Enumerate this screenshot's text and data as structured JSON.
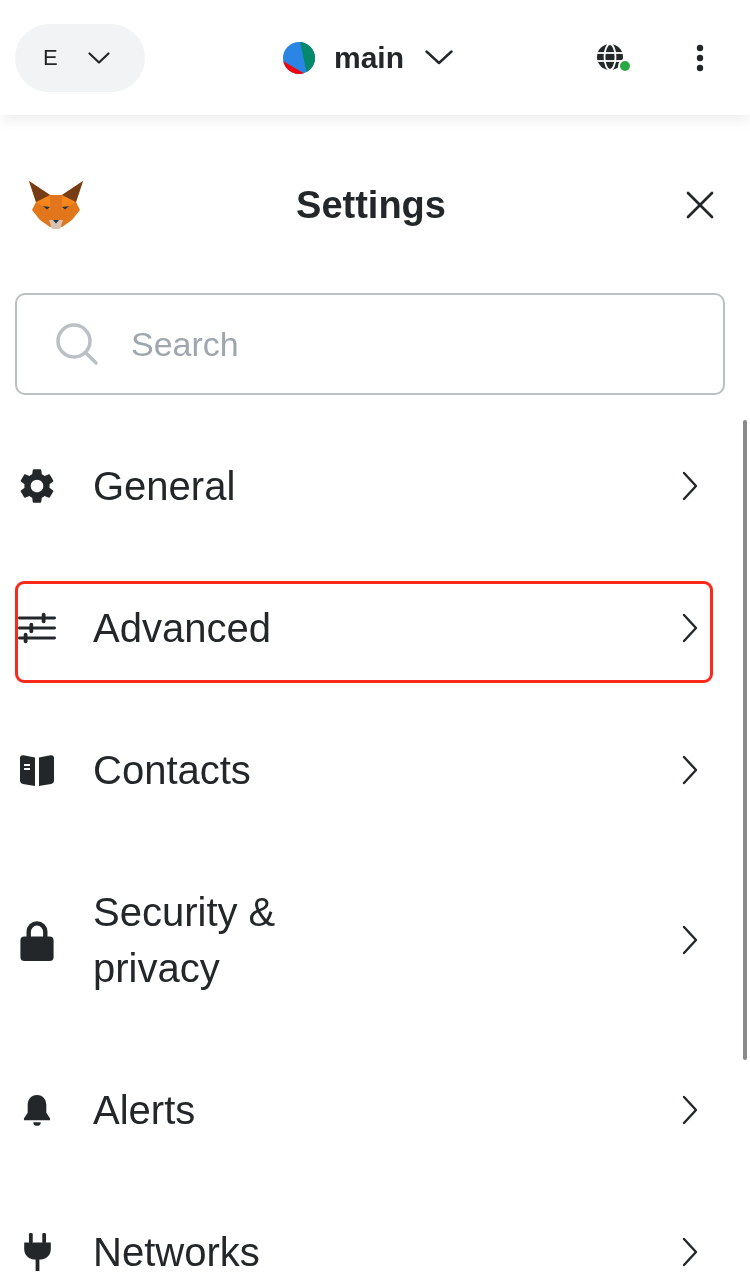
{
  "top_bar": {
    "account_button": {
      "label": "E"
    },
    "network": {
      "name": "main"
    },
    "site_connection": {
      "connected": true
    }
  },
  "settings": {
    "title": "Settings",
    "search": {
      "placeholder": "Search"
    },
    "items": [
      {
        "label": "General",
        "highlighted": false
      },
      {
        "label": "Advanced",
        "highlighted": true
      },
      {
        "label": "Contacts",
        "highlighted": false
      },
      {
        "label": "Security & privacy",
        "highlighted": false
      },
      {
        "label": "Alerts",
        "highlighted": false
      },
      {
        "label": "Networks",
        "highlighted": false
      }
    ]
  }
}
